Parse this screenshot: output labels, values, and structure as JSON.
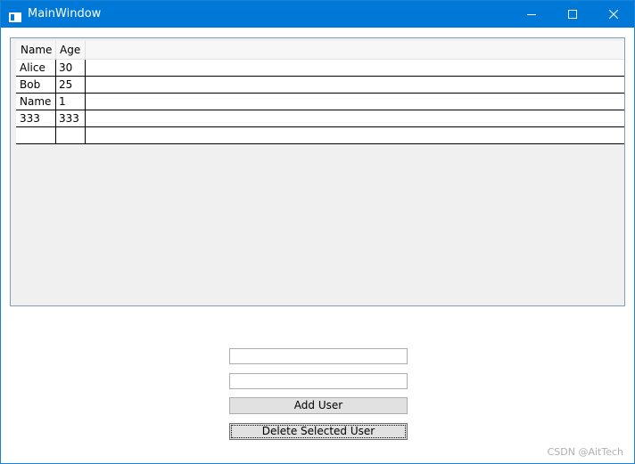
{
  "window": {
    "title": "MainWindow",
    "icon": "window-app-icon",
    "accent_color": "#0078d7",
    "controls": {
      "minimize_icon": "minimize-icon",
      "maximize_icon": "maximize-icon",
      "close_icon": "close-icon"
    }
  },
  "grid": {
    "columns": [
      "Name",
      "Age"
    ],
    "rows": [
      {
        "name": "Alice",
        "age": "30"
      },
      {
        "name": "Bob",
        "age": "25"
      },
      {
        "name": "Name",
        "age": "1"
      },
      {
        "name": "333",
        "age": "333"
      },
      {
        "name": "",
        "age": ""
      }
    ]
  },
  "form": {
    "name_input_value": "",
    "age_input_value": "",
    "add_button_label": "Add User",
    "delete_button_label": "Delete Selected User"
  },
  "watermark": "CSDN @AitTech"
}
